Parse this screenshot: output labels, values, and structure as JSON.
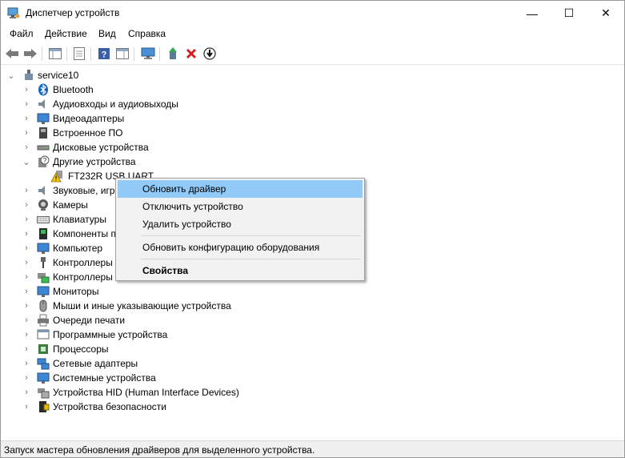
{
  "window": {
    "title": "Диспетчер устройств"
  },
  "window_controls": {
    "minimize": "—",
    "maximize": "☐",
    "close": "✕"
  },
  "menu": [
    "Файл",
    "Действие",
    "Вид",
    "Справка"
  ],
  "tree": {
    "root": "service10",
    "categories": [
      "Bluetooth",
      "Аудиовходы и аудиовыходы",
      "Видеоадаптеры",
      "Встроенное ПО",
      "Дисковые устройства",
      "Другие устройства",
      "FT232R USB UART",
      "Звуковые, игр",
      "Камеры",
      "Клавиатуры",
      "Компоненты п",
      "Компьютер",
      "Контроллеры",
      "Контроллеры",
      "Мониторы",
      "Мыши и иные указывающие устройства",
      "Очереди печати",
      "Программные устройства",
      "Процессоры",
      "Сетевые адаптеры",
      "Системные устройства",
      "Устройства HID (Human Interface Devices)",
      "Устройства безопасности"
    ]
  },
  "context_menu": {
    "items": [
      "Обновить драйвер",
      "Отключить устройство",
      "Удалить устройство",
      "Обновить конфигурацию оборудования",
      "Свойства"
    ],
    "highlighted": "Обновить драйвер"
  },
  "statusbar": {
    "text": "Запуск мастера обновления драйверов для выделенного устройства."
  },
  "colors": {
    "highlight": "#91c9f7",
    "menu_bg": "#f2f2f2",
    "status_bg": "#f0f0f0"
  }
}
